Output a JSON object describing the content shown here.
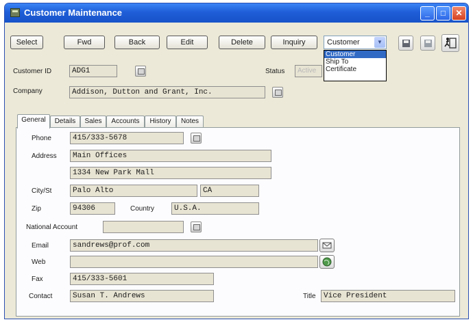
{
  "window": {
    "title": "Customer Maintenance",
    "minimize": "_",
    "maximize": "□",
    "close": "✕"
  },
  "toolbar": {
    "select": "Select",
    "fwd": "Fwd",
    "back": "Back",
    "edit": "Edit",
    "delete": "Delete",
    "inquiry": "Inquiry",
    "type_value": "Customer",
    "type_options": [
      "Customer",
      "Ship To",
      "Certificate"
    ]
  },
  "icons": [
    "app-icon",
    "save-icon",
    "save-disabled-icon",
    "exit-icon",
    "lookup-icon",
    "email-icon",
    "web-icon",
    "chevron-down-icon"
  ],
  "header": {
    "customer_id_label": "Customer ID",
    "customer_id": "ADG1",
    "status_label": "Status",
    "status_value": "Active",
    "company_label": "Company",
    "company": "Addison, Dutton and Grant, Inc."
  },
  "tabs": [
    "General",
    "Details",
    "Sales",
    "Accounts",
    "History",
    "Notes"
  ],
  "general": {
    "phone_label": "Phone",
    "phone": "415/333-5678",
    "address_label": "Address",
    "address1": "Main Offices",
    "address2": "1334 New Park Mall",
    "city_label": "City/St",
    "city": "Palo Alto",
    "state": "CA",
    "zip_label": "Zip",
    "zip": "94306",
    "country_label": "Country",
    "country": "U.S.A.",
    "national_label": "National Account",
    "national": "",
    "email_label": "Email",
    "email": "sandrews@prof.com",
    "web_label": "Web",
    "web": "",
    "fax_label": "Fax",
    "fax": "415/333-5601",
    "contact_label": "Contact",
    "contact": "Susan T. Andrews",
    "title_label": "Title",
    "title": "Vice President"
  }
}
